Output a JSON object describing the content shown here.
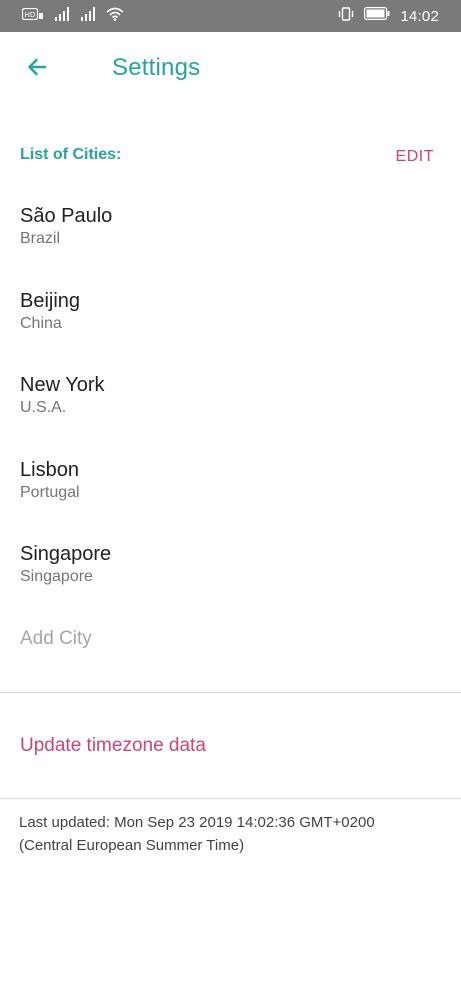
{
  "status_bar": {
    "time": "14:02",
    "icons": [
      "hd-icon",
      "signal-icon",
      "signal-icon",
      "wifi-icon",
      "vibrate-icon",
      "battery-icon"
    ]
  },
  "app_bar": {
    "back_icon": "arrow-left-icon",
    "title": "Settings"
  },
  "cities_section": {
    "title": "List of Cities:",
    "edit_label": "EDIT",
    "items": [
      {
        "city": "São Paulo",
        "country": "Brazil"
      },
      {
        "city": "Beijing",
        "country": "China"
      },
      {
        "city": "New York",
        "country": "U.S.A."
      },
      {
        "city": "Lisbon",
        "country": "Portugal"
      },
      {
        "city": "Singapore",
        "country": "Singapore"
      }
    ],
    "add_city_label": "Add City"
  },
  "timezone": {
    "update_label": "Update timezone data",
    "last_updated_line1": "Last updated: Mon Sep 23 2019 14:02:36 GMT+0200",
    "last_updated_line2": "(Central European Summer Time)"
  },
  "colors": {
    "accent": "#26a69a",
    "pink": "#d0446f",
    "status_bar": "#7a7a7a"
  }
}
